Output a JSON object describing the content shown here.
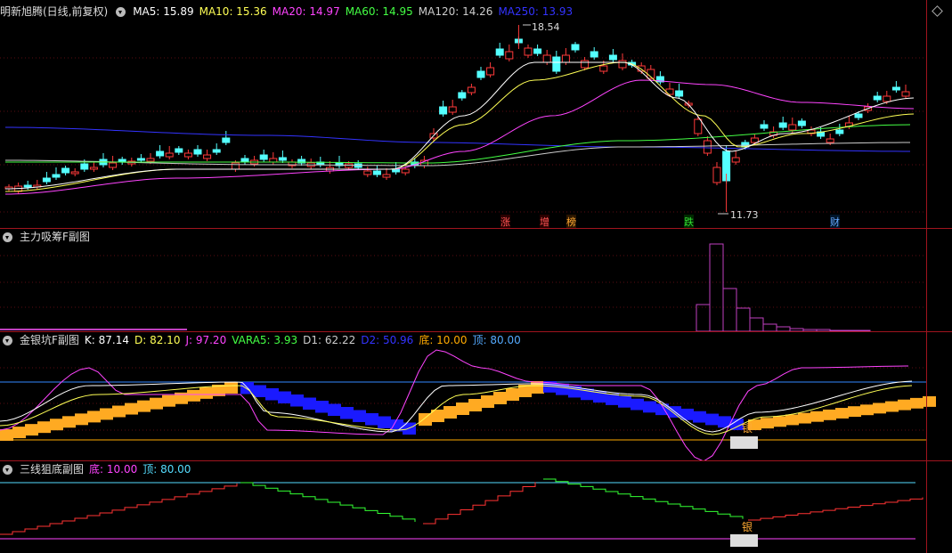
{
  "main": {
    "title": "明新旭腾(日线,前复权)",
    "ma": [
      {
        "label": "MA5: 15.89",
        "color": "#ffffff"
      },
      {
        "label": "MA10: 15.36",
        "color": "#ffff55"
      },
      {
        "label": "MA20: 14.97",
        "color": "#ff44ff"
      },
      {
        "label": "MA60: 14.95",
        "color": "#44ff44"
      },
      {
        "label": "MA120: 14.26",
        "color": "#cccccc"
      },
      {
        "label": "MA250: 13.93",
        "color": "#3333ff"
      }
    ],
    "high_label": "18.54",
    "low_label": "11.73",
    "markers": [
      {
        "text": "涨",
        "color": "#ff5555"
      },
      {
        "text": "增",
        "color": "#ff5555"
      },
      {
        "text": "榜",
        "color": "#ffaa33"
      },
      {
        "text": "跌",
        "color": "#33dd33"
      },
      {
        "text": "财",
        "color": "#66aaff"
      }
    ]
  },
  "sub1": {
    "title": "主力吸筹F副图"
  },
  "sub2": {
    "title": "金银坑F副图",
    "indicators": [
      {
        "label": "K: 87.14",
        "color": "#ffffff"
      },
      {
        "label": "D: 82.10",
        "color": "#ffff55"
      },
      {
        "label": "J: 97.20",
        "color": "#ff44ff"
      },
      {
        "label": "VARA5: 3.93",
        "color": "#44ff44"
      },
      {
        "label": "D1: 62.22",
        "color": "#cccccc"
      },
      {
        "label": "D2: 50.96",
        "color": "#3333ff"
      },
      {
        "label": "底: 10.00",
        "color": "#ffaa00"
      },
      {
        "label": "顶: 80.00",
        "color": "#55aaff"
      }
    ],
    "silver_label": "银"
  },
  "sub3": {
    "title": "三线狙底副图",
    "indicators": [
      {
        "label": "底: 10.00",
        "color": "#ff44ff"
      },
      {
        "label": "顶: 80.00",
        "color": "#55ddff"
      }
    ],
    "silver_label": "银"
  }
}
